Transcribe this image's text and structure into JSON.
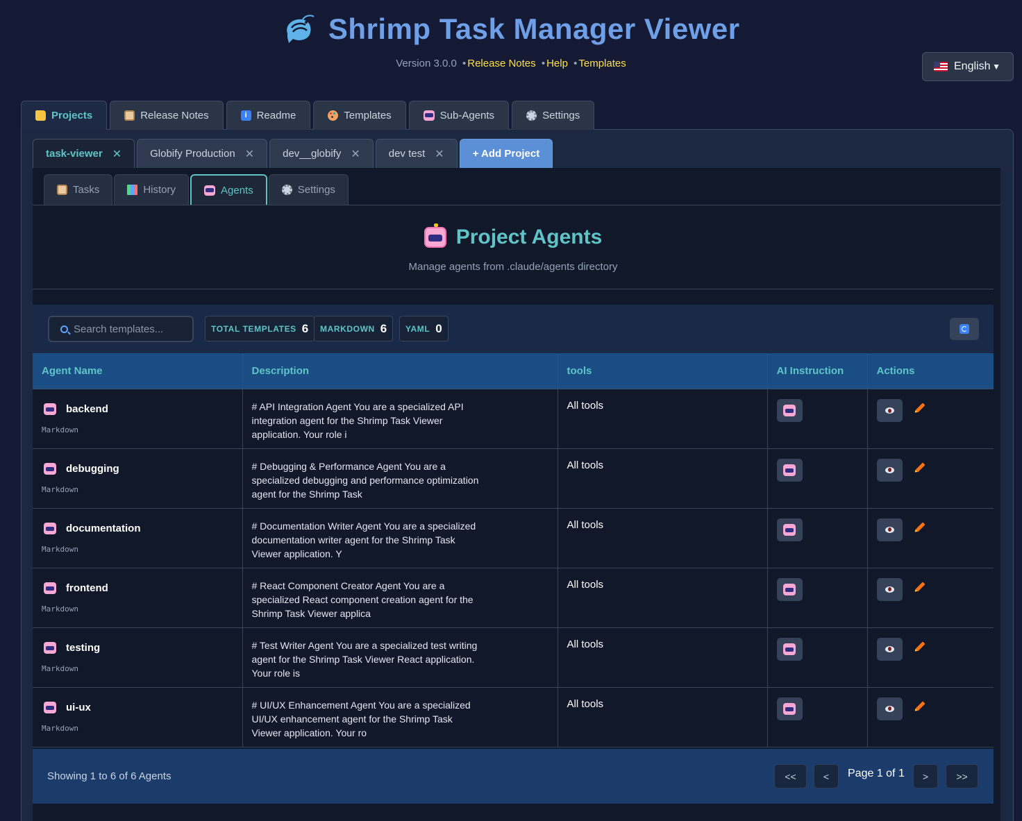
{
  "app": {
    "title": "Shrimp Task Manager Viewer",
    "version": "Version 3.0.0",
    "links": [
      "Release Notes",
      "Help",
      "Templates"
    ]
  },
  "language": {
    "selected": "English"
  },
  "main_tabs": [
    {
      "label": "Projects",
      "icon": "folder-icon",
      "active": true
    },
    {
      "label": "Release Notes",
      "icon": "notes-icon"
    },
    {
      "label": "Readme",
      "icon": "info-icon"
    },
    {
      "label": "Templates",
      "icon": "palette-icon"
    },
    {
      "label": "Sub-Agents",
      "icon": "robot-icon"
    },
    {
      "label": "Settings",
      "icon": "gear-icon"
    }
  ],
  "project_tabs": [
    {
      "label": "task-viewer",
      "active": true
    },
    {
      "label": "Globify Production"
    },
    {
      "label": "dev__globify"
    },
    {
      "label": "dev test"
    }
  ],
  "add_project_label": "+ Add Project",
  "sub_tabs": [
    {
      "label": "Tasks",
      "icon": "clipboard-icon"
    },
    {
      "label": "History",
      "icon": "chart-icon"
    },
    {
      "label": "Agents",
      "icon": "robot-icon",
      "active": true
    },
    {
      "label": "Settings",
      "icon": "gear-icon"
    }
  ],
  "agents_page": {
    "title": "Project Agents",
    "subtitle": "Manage agents from .claude/agents directory"
  },
  "toolbar": {
    "search_placeholder": "Search templates...",
    "stats": [
      {
        "label": "TOTAL TEMPLATES",
        "value": "6"
      },
      {
        "label": "MARKDOWN",
        "value": "6"
      },
      {
        "label": "YAML",
        "value": "0"
      }
    ]
  },
  "table": {
    "columns": [
      "Agent Name",
      "Description",
      "tools",
      "AI Instruction",
      "Actions"
    ],
    "rows": [
      {
        "name": "backend",
        "type": "Markdown",
        "description": "# API Integration Agent You are a specialized API integration agent for the Shrimp Task Viewer application. Your role i",
        "tools": "All tools"
      },
      {
        "name": "debugging",
        "type": "Markdown",
        "description": "# Debugging & Performance Agent You are a specialized debugging and performance optimization agent for the Shrimp Task",
        "tools": "All tools"
      },
      {
        "name": "documentation",
        "type": "Markdown",
        "description": "# Documentation Writer Agent You are a specialized documentation writer agent for the Shrimp Task Viewer application. Y",
        "tools": "All tools"
      },
      {
        "name": "frontend",
        "type": "Markdown",
        "description": "# React Component Creator Agent You are a specialized React component creation agent for the Shrimp Task Viewer applica",
        "tools": "All tools"
      },
      {
        "name": "testing",
        "type": "Markdown",
        "description": "# Test Writer Agent You are a specialized test writing agent for the Shrimp Task Viewer React application. Your role is",
        "tools": "All tools"
      },
      {
        "name": "ui-ux",
        "type": "Markdown",
        "description": "# UI/UX Enhancement Agent You are a specialized UI/UX enhancement agent for the Shrimp Task Viewer application. Your ro",
        "tools": "All tools"
      }
    ]
  },
  "pagination": {
    "showing": "Showing 1 to 6 of 6 Agents",
    "page_text": "Page 1 of 1",
    "first": "<<",
    "prev": "<",
    "next": ">",
    "last": ">>"
  }
}
